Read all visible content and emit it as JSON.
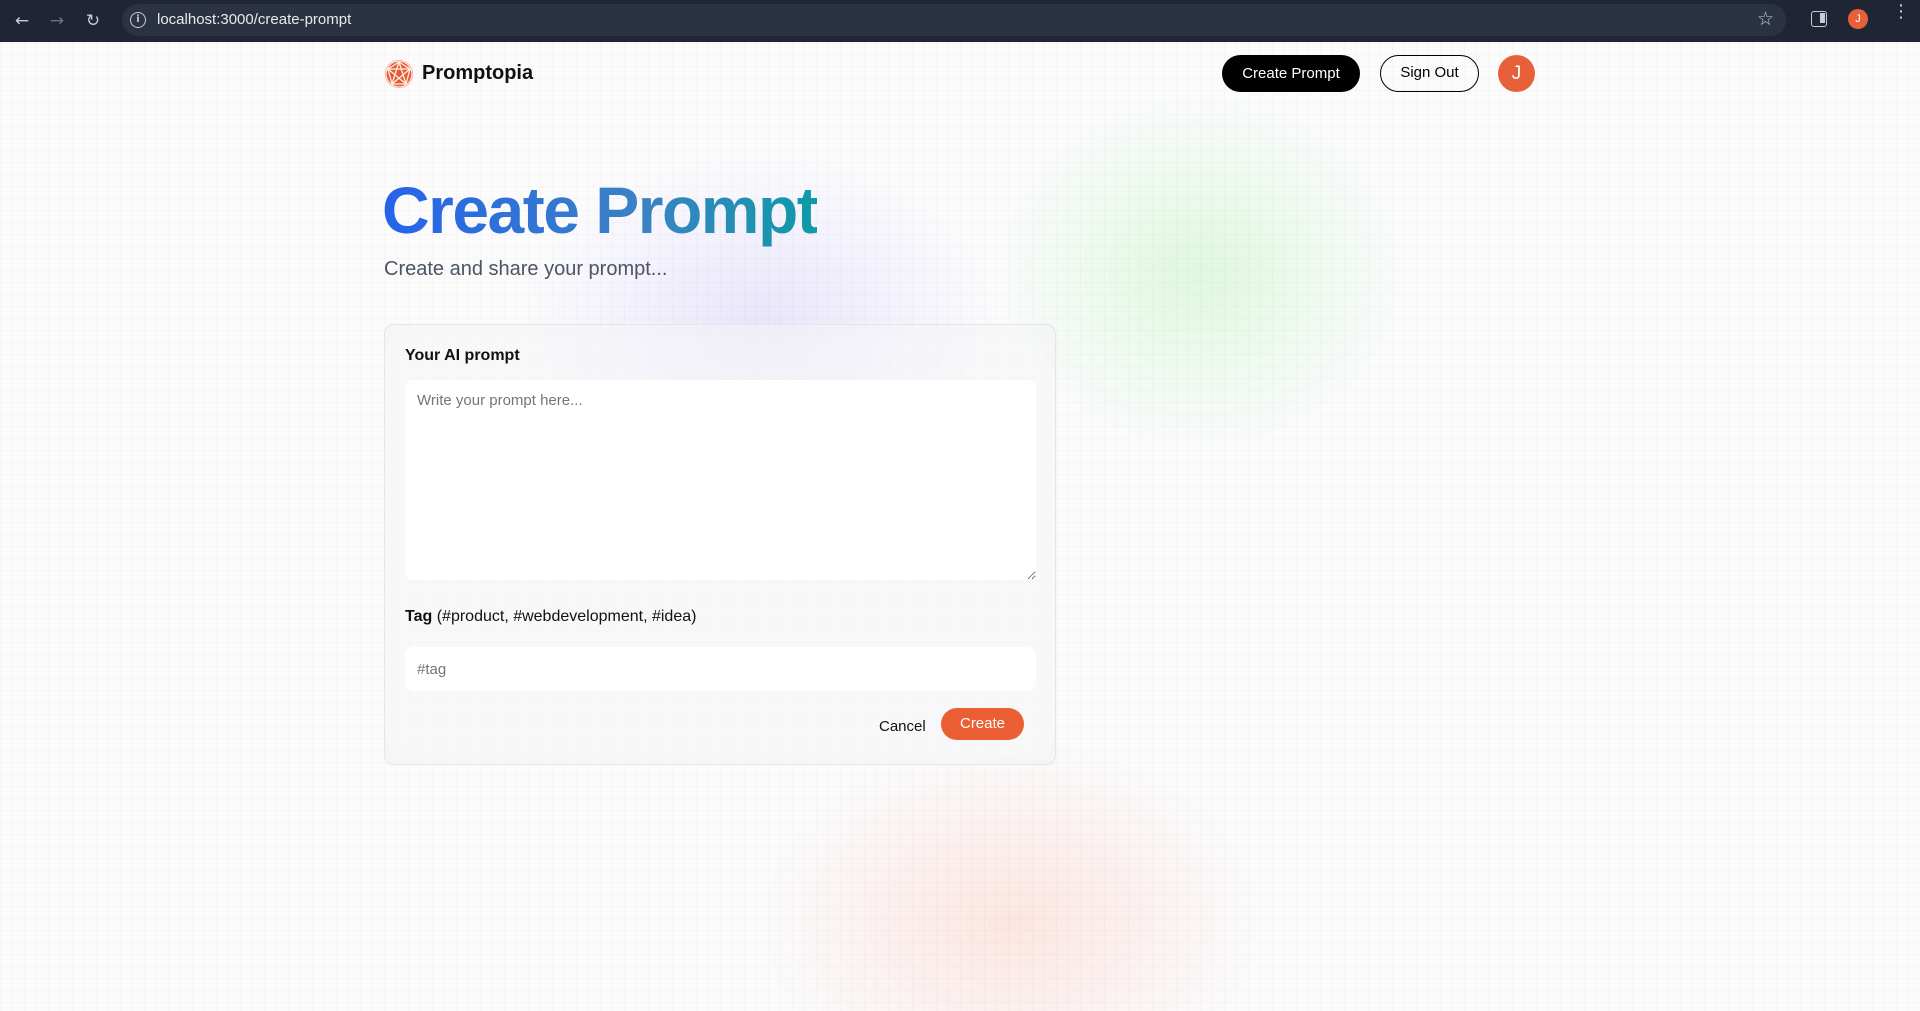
{
  "browser": {
    "url": "localhost:3000/create-prompt",
    "profile_initial": "J"
  },
  "nav": {
    "brand": "Promptopia",
    "create_prompt_label": "Create Prompt",
    "sign_out_label": "Sign Out",
    "avatar_initial": "J"
  },
  "header": {
    "title": "Create Prompt",
    "subtitle": "Create and share your prompt..."
  },
  "form": {
    "prompt_label": "Your AI prompt",
    "prompt_placeholder": "Write your prompt here...",
    "prompt_value": "",
    "tag_label_bold": "Tag",
    "tag_label_hint": "(#product, #webdevelopment, #idea)",
    "tag_placeholder": "#tag",
    "tag_value": "",
    "cancel_label": "Cancel",
    "create_label": "Create"
  },
  "colors": {
    "accent": "#ec5f34",
    "title_gradient_start": "#2563eb",
    "title_gradient_end": "#0e9aa7"
  }
}
